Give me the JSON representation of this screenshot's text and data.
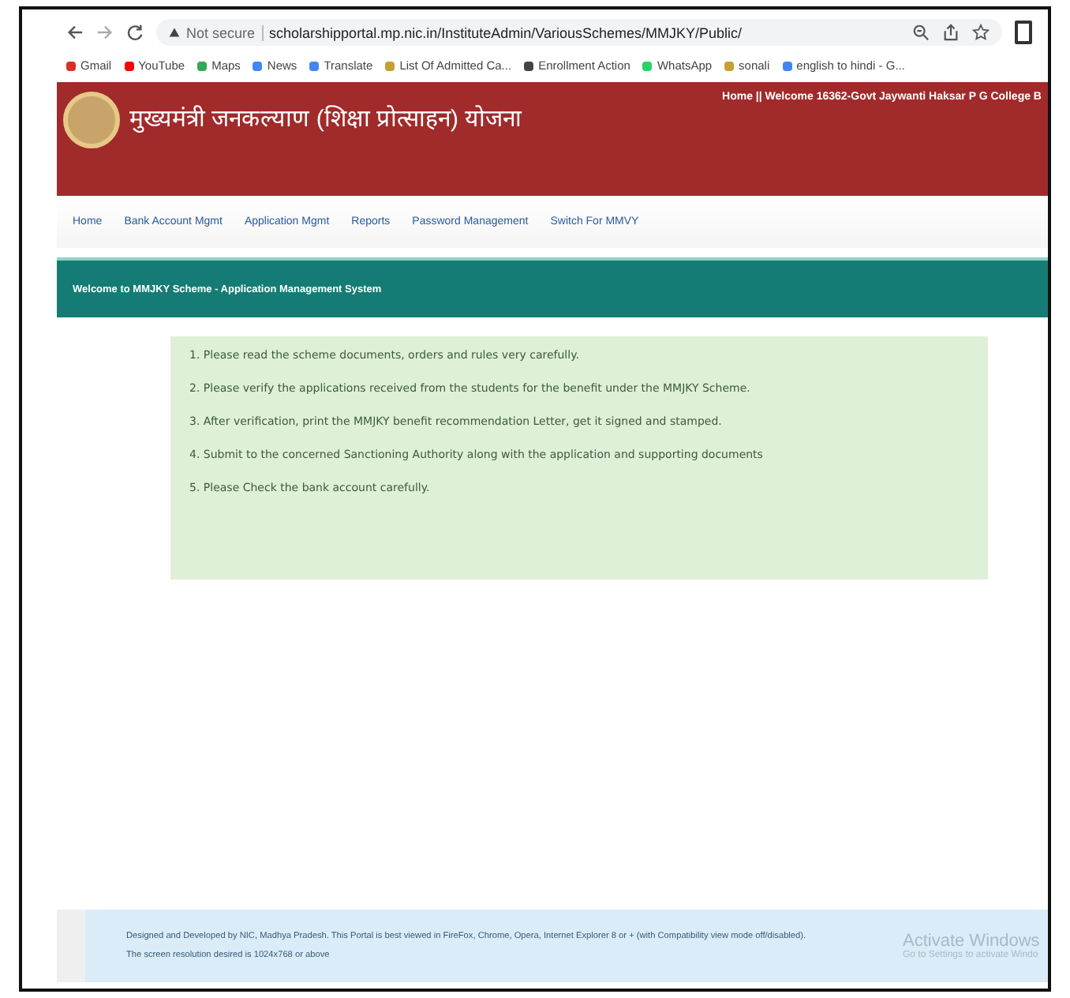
{
  "browser": {
    "security": "Not secure",
    "url": "scholarshipportal.mp.nic.in/InstituteAdmin/VariousSchemes/MMJKY/Public/"
  },
  "bookmarks": [
    {
      "label": "Gmail",
      "color": "#d93025"
    },
    {
      "label": "YouTube",
      "color": "#ff0000"
    },
    {
      "label": "Maps",
      "color": "#34a853"
    },
    {
      "label": "News",
      "color": "#4285f4"
    },
    {
      "label": "Translate",
      "color": "#4285f4"
    },
    {
      "label": "List Of Admitted Ca...",
      "color": "#c8a030"
    },
    {
      "label": "Enrollment Action",
      "color": "#444444"
    },
    {
      "label": "WhatsApp",
      "color": "#25d366"
    },
    {
      "label": "sonali",
      "color": "#c8a030"
    },
    {
      "label": "english to hindi - G...",
      "color": "#4285f4"
    }
  ],
  "header": {
    "title": "मुख्यमंत्री जनकल्याण (शिक्षा प्रोत्साहन) योजना",
    "welcome": "Home || Welcome 16362-Govt Jaywanti Haksar P G College B"
  },
  "nav": [
    "Home",
    "Bank Account Mgmt",
    "Application Mgmt",
    "Reports",
    "Password Management",
    "Switch For MMVY"
  ],
  "banner": "Welcome to MMJKY Scheme - Application Management System",
  "instructions": [
    "1. Please read the scheme documents, orders and rules very carefully.",
    "2. Please verify the applications received from the students for the benefit under the MMJKY Scheme.",
    "3. After verification, print the MMJKY benefit recommendation Letter, get it signed and stamped.",
    "4. Submit to the concerned Sanctioning Authority along with the application and supporting documents",
    "5. Please Check the bank account carefully."
  ],
  "footer": [
    "Designed and Developed by NIC, Madhya Pradesh. This Portal is best viewed in FireFox, Chrome, Opera, Internet Explorer 8 or + (with Compatibility view mode off/disabled).",
    "The screen resolution desired is 1024x768 or above"
  ],
  "watermark": {
    "title": "Activate Windows",
    "subtitle": "Go to Settings to activate Windo"
  }
}
